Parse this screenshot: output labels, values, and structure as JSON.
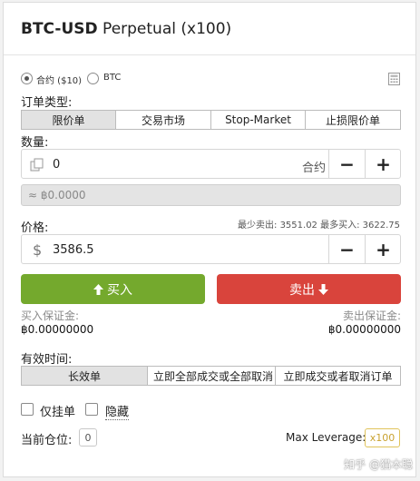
{
  "header": {
    "title_bold": "BTC-USD",
    "title_rest": " Perpetual (x100)"
  },
  "unit": {
    "contract_label": "合约 ($10)",
    "btc_label": "BTC"
  },
  "order_type": {
    "label": "订单类型:",
    "options": [
      "限价单",
      "交易市场",
      "Stop-Market",
      "止损限价单"
    ],
    "selected": "限价单"
  },
  "quantity": {
    "label": "数量:",
    "value": "0",
    "unit": "合约",
    "minus": "−",
    "plus": "+"
  },
  "cost": {
    "value": "≈ ฿0.0000"
  },
  "price": {
    "label": "价格:",
    "currency_symbol": "$",
    "value": "3586.5",
    "min_sell_label": "最少卖出:",
    "min_sell_value": "3551.02",
    "max_buy_label": "最多买入:",
    "max_buy_value": "3622.75",
    "minus": "−",
    "plus": "+"
  },
  "actions": {
    "buy_label": "买入",
    "sell_label": "卖出",
    "buy_color": "#74a92d",
    "sell_color": "#d9443c"
  },
  "margin": {
    "buy_label": "买入保证金:",
    "buy_value": "฿0.00000000",
    "sell_label": "卖出保证金:",
    "sell_value": "฿0.00000000"
  },
  "time_in_force": {
    "label": "有效时间:",
    "options": [
      "长效单",
      "立即全部成交或全部取消",
      "立即成交或者取消订单"
    ],
    "selected": "长效单"
  },
  "options": {
    "post_only": "仅挂单",
    "hidden": "隐藏"
  },
  "footer": {
    "position_label": "当前仓位:",
    "position_value": "0",
    "leverage_label": "Max Leverage:",
    "leverage_value": "x100",
    "leverage_color": "#e0c35a"
  },
  "watermark": "知乎 @猫本聪",
  "icons": {
    "calculator": "calculator-icon",
    "copy": "copy-icon",
    "buy_arrow": "arrow-up-icon",
    "sell_arrow": "arrow-down-icon"
  }
}
